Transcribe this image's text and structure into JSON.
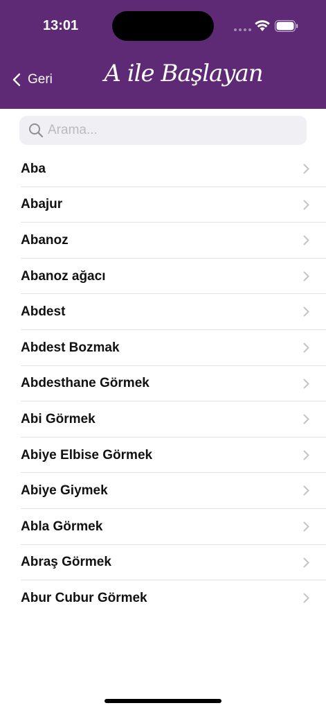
{
  "status_bar": {
    "time": "13:01"
  },
  "nav": {
    "back_label": "Geri",
    "title": "A ile Başlayan",
    "background": "#5f2a75"
  },
  "search": {
    "placeholder": "Arama...",
    "value": ""
  },
  "items": [
    {
      "label": "Aba"
    },
    {
      "label": "Abajur"
    },
    {
      "label": "Abanoz"
    },
    {
      "label": "Abanoz ağacı"
    },
    {
      "label": "Abdest"
    },
    {
      "label": "Abdest Bozmak"
    },
    {
      "label": "Abdesthane Görmek"
    },
    {
      "label": "Abi Görmek"
    },
    {
      "label": "Abiye Elbise Görmek"
    },
    {
      "label": "Abiye Giymek"
    },
    {
      "label": "Abla Görmek"
    },
    {
      "label": "Abraş Görmek"
    },
    {
      "label": "Abur Cubur Görmek"
    }
  ],
  "icons": {
    "back": "chevron-left-icon",
    "search": "magnifier-icon",
    "row": "chevron-right-icon",
    "wifi": "wifi-icon",
    "battery": "battery-icon"
  }
}
